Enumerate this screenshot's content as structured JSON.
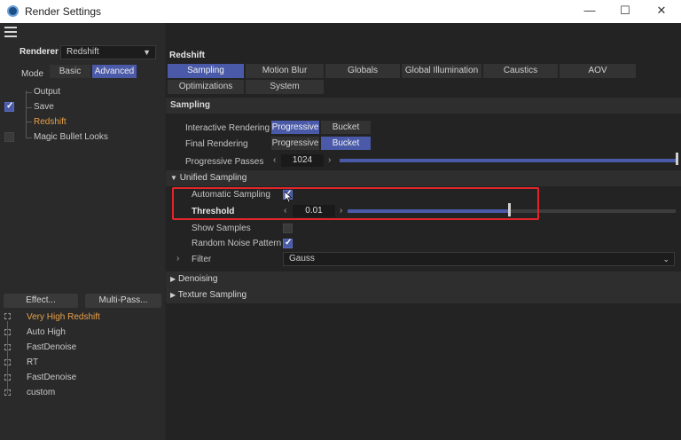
{
  "window": {
    "title": "Render Settings",
    "minimize": "—",
    "maximize": "☐",
    "close": "✕"
  },
  "left": {
    "renderer_label": "Renderer",
    "renderer_value": "Redshift",
    "mode_label": "Mode",
    "mode_options": [
      "Basic",
      "Advanced"
    ],
    "mode_selected": "Advanced",
    "tree": [
      "Output",
      "Save",
      "Redshift",
      "Magic Bullet Looks"
    ],
    "effect_button": "Effect...",
    "multipass_button": "Multi-Pass...",
    "presets": [
      "Very High Redshift",
      "Auto High",
      "FastDenoise",
      "RT",
      "FastDenoise",
      "custom"
    ]
  },
  "right": {
    "panel_title": "Redshift",
    "tabs_row1": [
      "Sampling",
      "Motion Blur",
      "Globals",
      "Global Illumination",
      "Caustics",
      "AOV"
    ],
    "tabs_row2": [
      "Optimizations",
      "System"
    ],
    "active_tab": "Sampling",
    "section_title": "Sampling",
    "interactive_rendering_label": "Interactive Rendering",
    "interactive_options": [
      "Progressive",
      "Bucket"
    ],
    "interactive_selected": "Progressive",
    "final_rendering_label": "Final Rendering",
    "final_options": [
      "Progressive",
      "Bucket"
    ],
    "final_selected": "Bucket",
    "progressive_passes_label": "Progressive Passes",
    "progressive_passes_value": "1024",
    "progressive_passes_fill": 1.0,
    "unified_sampling_title": "Unified Sampling",
    "automatic_sampling_label": "Automatic Sampling",
    "automatic_sampling_checked": true,
    "threshold_label": "Threshold",
    "threshold_value": "0.01",
    "threshold_fill": 0.49,
    "show_samples_label": "Show Samples",
    "show_samples_checked": false,
    "random_noise_label": "Random Noise Pattern",
    "random_noise_checked": true,
    "filter_label": "Filter",
    "filter_value": "Gauss",
    "denoising_title": "Denoising",
    "texture_sampling_title": "Texture Sampling"
  },
  "colors": {
    "accent": "#4a5aa8",
    "highlight_orange": "#e8a048",
    "annotation_red": "#e2252b"
  }
}
